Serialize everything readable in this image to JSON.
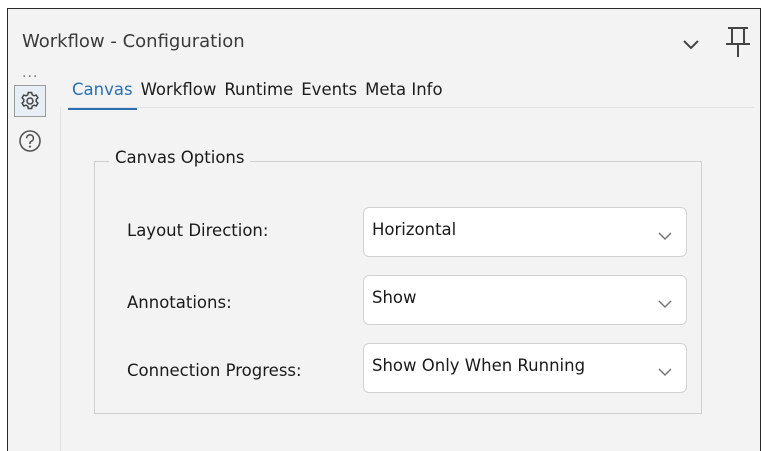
{
  "panel": {
    "title": "Workflow - Configuration",
    "more_dots": "···"
  },
  "tabs": [
    {
      "label": "Canvas",
      "active": true
    },
    {
      "label": "Workflow",
      "active": false
    },
    {
      "label": "Runtime",
      "active": false
    },
    {
      "label": "Events",
      "active": false
    },
    {
      "label": "Meta Info",
      "active": false
    }
  ],
  "canvas_options": {
    "title": "Canvas Options",
    "rows": [
      {
        "label": "Layout Direction:",
        "value": "Horizontal"
      },
      {
        "label": "Annotations:",
        "value": "Show"
      },
      {
        "label": "Connection Progress:",
        "value": "Show Only When Running"
      }
    ]
  },
  "icons": {
    "collapse": "chevron-down-icon",
    "pin": "pin-icon",
    "settings": "gear-icon",
    "help": "help-icon"
  },
  "colors": {
    "accent": "#2a6fb0",
    "panel_bg": "#f3f3f3",
    "field_bg": "#ffffff"
  }
}
